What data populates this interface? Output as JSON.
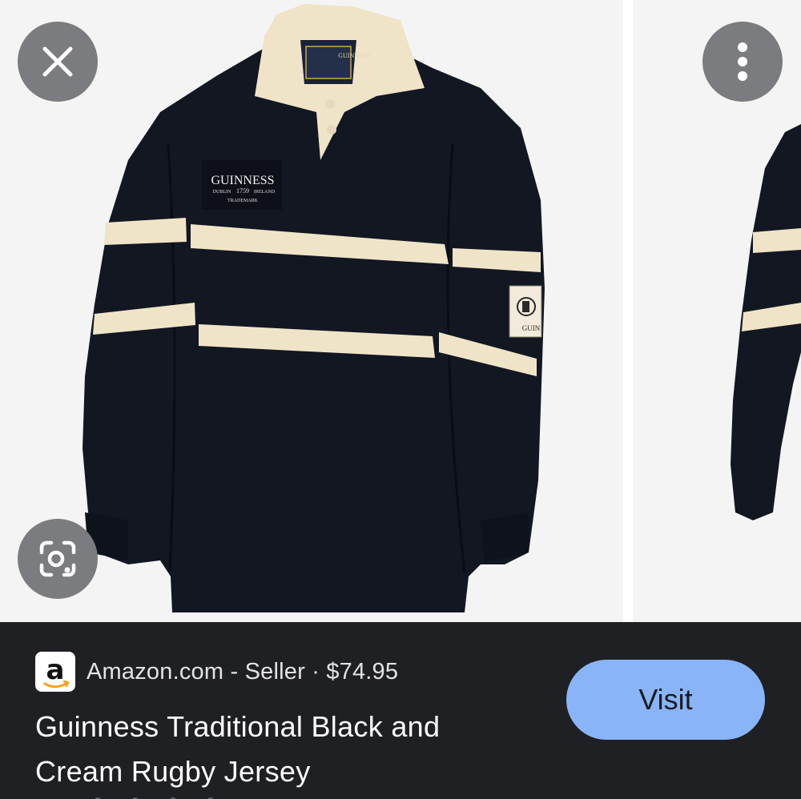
{
  "viewer": {
    "main_image": {
      "brand": "GUINNESS",
      "year": "1759",
      "left_text": "DUBLIN",
      "right_text": "IRELAND",
      "trademark": "TRADEMARK",
      "collar_label": "GUINNESS",
      "sleeve_patch": "GUIN"
    },
    "buttons": {
      "close_icon": "close-icon",
      "more_icon": "more-vert-icon",
      "lens_icon": "lens-icon"
    }
  },
  "result": {
    "source_logo": "a",
    "source_line": "Amazon.com - Seller · $74.95",
    "title_line1": "Guinness Traditional Black and",
    "title_line2": "Cream Rugby Jersey",
    "visit_label": "Visit"
  },
  "colors": {
    "panel_bg": "#1f2023",
    "visit_bg": "#8ab4f8",
    "jersey": "#121722",
    "stripe": "#f0e4c8"
  }
}
